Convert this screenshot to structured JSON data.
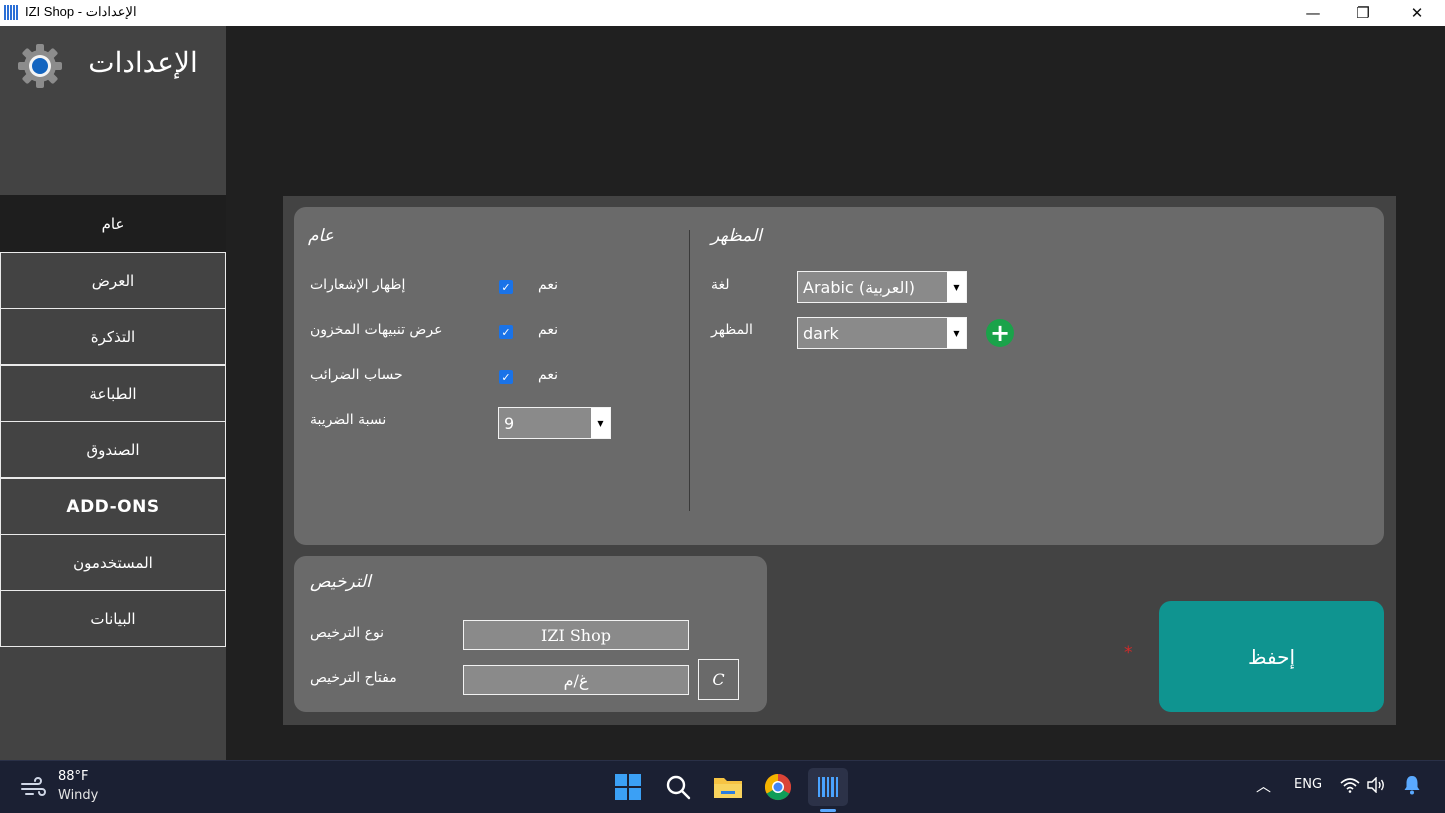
{
  "window": {
    "title": "IZI Shop - الإعدادات",
    "minimize": "—",
    "maximize": "❐",
    "close": "✕"
  },
  "sidebar": {
    "header_title": "الإعدادات",
    "items": [
      {
        "label": "عام",
        "active": true
      },
      {
        "label": "العرض"
      },
      {
        "label": "التذكرة"
      },
      {
        "label": "الطباعة"
      },
      {
        "label": "الصندوق"
      },
      {
        "label": "ADD-ONS"
      },
      {
        "label": "المستخدمون"
      },
      {
        "label": "البيانات"
      }
    ]
  },
  "general": {
    "title": "عام",
    "rows": [
      {
        "label": "إظهار الإشعارات",
        "value": "نعم",
        "checked": true
      },
      {
        "label": "عرض تنبيهات المخزون",
        "value": "نعم",
        "checked": true
      },
      {
        "label": "حساب الضرائب",
        "value": "نعم",
        "checked": true
      }
    ],
    "tax_label": "نسبة الضريبة",
    "tax_value": "9"
  },
  "appearance": {
    "title": "المظهر",
    "language_label": "لغة",
    "language_value": "Arabic (العربية)",
    "theme_label": "المظهر",
    "theme_value": "dark"
  },
  "license": {
    "title": "الترخيص",
    "type_label": "نوع الترخيص",
    "type_value": "IZI Shop",
    "key_label": "مفتاح الترخيص",
    "key_value": "غ/م",
    "c_button": "C"
  },
  "save": {
    "label": "إحفظ",
    "asterisk": "*"
  },
  "taskbar": {
    "temperature": "88°F",
    "condition": "Windy",
    "language": "ENG"
  },
  "colors": {
    "accent_save": "#0f9490",
    "add_green": "#1aa34a",
    "checkbox_blue": "#1a73e8",
    "required_red": "#d12a2a"
  }
}
